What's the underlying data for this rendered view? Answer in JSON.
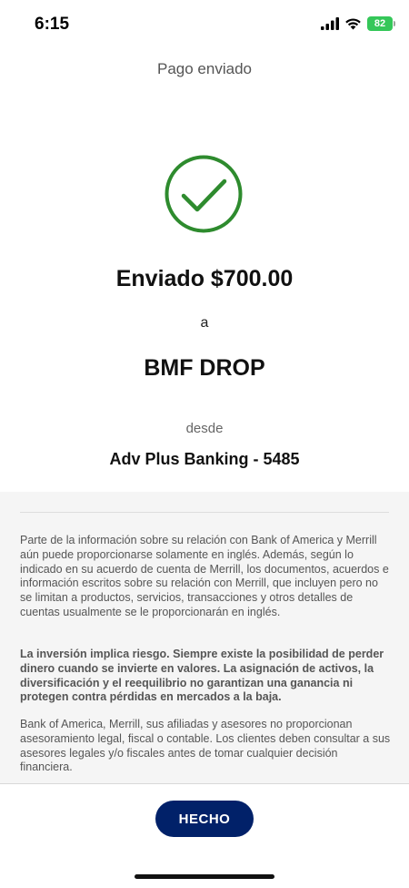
{
  "status_bar": {
    "time": "6:15",
    "battery": "82",
    "battery_color": "#35c759"
  },
  "header": {
    "title": "Pago enviado"
  },
  "confirmation": {
    "icon": "check-circle-icon",
    "icon_color": "#2e8b2e",
    "sent_amount": "Enviado $700.00",
    "to_word": "a",
    "recipient": "BMF DROP",
    "from_word": "desde",
    "account": "Adv Plus Banking - 5485"
  },
  "disclosure": {
    "p1": "Parte de la información sobre su relación con Bank of America y Merrill aún puede proporcionarse solamente en inglés. Además, según lo indicado en su acuerdo de cuenta de Merrill, los documentos, acuerdos e información escritos sobre su relación con Merrill, que incluyen pero no se limitan a productos, servicios, transacciones y otros detalles de cuentas usualmente se le proporcionarán en inglés.",
    "p2": "La inversión implica riesgo. Siempre existe la posibilidad de perder dinero cuando se invierte en valores. La asignación de activos, la diversificación y el reequilibrio no garantizan una ganancia ni protegen contra pérdidas en mercados a la baja.",
    "p3": "Bank of America, Merrill, sus afiliadas y asesores no proporcionan asesoramiento legal, fiscal o contable. Los clientes deben consultar a sus asesores legales y/o fiscales antes de tomar cualquier decisión financiera."
  },
  "footer": {
    "done_label": "HECHO",
    "done_color": "#012169"
  }
}
